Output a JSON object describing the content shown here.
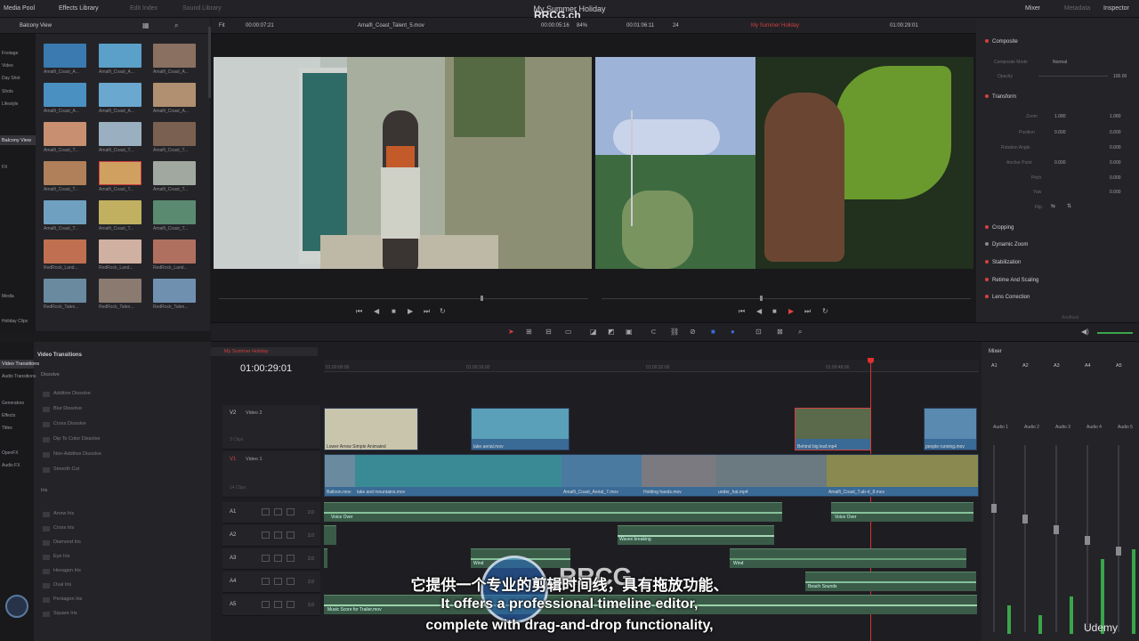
{
  "topbar": {
    "tabs": [
      "Media Pool",
      "Effects Library",
      "Edit Index",
      "Sound Library"
    ],
    "right_tabs": [
      "Mixer",
      "Metadata",
      "Inspector"
    ],
    "project_title": "My Summer Holiday",
    "watermark": "RRCG.ch"
  },
  "viewer_header": {
    "fit": "Fit",
    "source_tc": "00:00:07:21",
    "source_clip": "Amalfi_Coast_Talent_5.mov",
    "duration_tc": "00:00:05:16",
    "zoom": "84%",
    "timeline_tc_small": "00:01:06:11",
    "fps": "24",
    "timeline_name": "My Summer Holiday",
    "timeline_tc": "01:00:29:01"
  },
  "media_pool": {
    "bin_title": "Balcony View",
    "sidebar": [
      "Footage",
      "Video",
      "Day Shot",
      "Shots",
      "Lifestyle",
      "Balcony View",
      "FX",
      "Media",
      "Holiday Clips"
    ],
    "clips": [
      "Amalfi_Coast_A...",
      "Amalfi_Coast_A...",
      "Amalfi_Coast_A...",
      "Amalfi_Coast_A...",
      "Amalfi_Coast_A...",
      "Amalfi_Coast_A...",
      "Amalfi_Coast_T...",
      "Amalfi_Coast_T...",
      "Amalfi_Coast_T...",
      "Amalfi_Coast_T...",
      "Amalfi_Coast_T...",
      "Amalfi_Coast_T...",
      "Amalfi_Coast_T...",
      "Amalfi_Coast_T...",
      "Amalfi_Coast_T...",
      "RedRock_Land...",
      "RedRock_Land...",
      "RedRock_Land...",
      "RedRock_Talen...",
      "RedRock_Talen...",
      "RedRock_Talen..."
    ]
  },
  "inspector": {
    "composite": "Composite",
    "composite_mode_label": "Composite Mode",
    "composite_mode_value": "Normal",
    "opacity_label": "Opacity",
    "opacity_value": "100.00",
    "transform": "Transform",
    "zoom_label": "Zoom",
    "zoom_x": "1.080",
    "zoom_y": "1.080",
    "position_label": "Position",
    "pos_x": "0.000",
    "pos_y": "0.000",
    "rotation_label": "Rotation Angle",
    "rotation_value": "0.000",
    "anchor_label": "Anchor Point",
    "anchor_x": "0.000",
    "anchor_y": "0.000",
    "pitch_label": "Pitch",
    "pitch_value": "0.000",
    "yaw_label": "Yaw",
    "yaw_value": "0.000",
    "flip_label": "Flip",
    "sections": [
      "Cropping",
      "Dynamic Zoom",
      "Stabilization",
      "Retime And Scaling",
      "Lens Correction"
    ],
    "footer": "Anaflash"
  },
  "effects": {
    "sidebar": [
      "Video Transitions",
      "Audio Transitions",
      "Generators",
      "Effects",
      "Titles",
      "OpenFX",
      "Audio FX"
    ],
    "title": "Video Transitions",
    "dissolve_header": "Dissolve",
    "dissolve": [
      "Additive Dissolve",
      "Blur Dissolve",
      "Cross Dissolve",
      "Dip To Color Dissolve",
      "Non-Additive Dissolve",
      "Smooth Cut"
    ],
    "iris_header": "Iris",
    "iris": [
      "Arrow Iris",
      "Cross Iris",
      "Diamond Iris",
      "Eye Iris",
      "Hexagon Iris",
      "Oval Iris",
      "Pentagon Iris",
      "Square Iris"
    ]
  },
  "timeline": {
    "tab": "My Summer Holiday",
    "timecode": "01:00:29:01",
    "ruler": [
      "01:00:00:00",
      "01:00:16:00",
      "01:00:32:00",
      "01:00:48:00"
    ],
    "tracks": {
      "v2": {
        "id": "V2",
        "name": "Video 2",
        "clips": "3 Clips"
      },
      "v1": {
        "id": "V1",
        "name": "Video 1",
        "clips": "14 Clips"
      },
      "audio": [
        "A1",
        "A2",
        "A3",
        "A4",
        "A5"
      ],
      "audio_level": "2.0"
    },
    "v2_clips": [
      "Lower Arrow Simple Animated",
      "lake aerial.mov",
      "Behind big leaf.mp4",
      "people running.mov"
    ],
    "v1_clips": [
      "Balloon.mov",
      "lake and mountains.mov",
      "Amalfi_Coast_Aerial_7.mov",
      "Holding hands.mov",
      "under_hat.mp4",
      "Amalfi_Coast_T.ab-rt_8.mov"
    ],
    "a_clips": [
      "Voice Over",
      "Voice Over",
      "Waves breaking",
      "Wind",
      "Wind",
      "Beach Sounds",
      "Music Score for Trailer.mov"
    ]
  },
  "mixer": {
    "title": "Mixer",
    "channels": [
      "A1",
      "A2",
      "A3",
      "A4",
      "A5"
    ],
    "buses": [
      "Audio 1",
      "Audio 2",
      "Audio 3",
      "Audio 4",
      "Audio 5"
    ],
    "meter_levels": [
      0.15,
      0.1,
      0.2,
      0.4,
      0.45
    ]
  },
  "subtitles": {
    "zh": "它提供一个专业的剪辑时间线，具有拖放功能、",
    "en1": "It offers a professional timeline editor,",
    "en2": "complete with drag-and-drop functionality,",
    "badge": "Udemy",
    "logo": "RRCG"
  }
}
